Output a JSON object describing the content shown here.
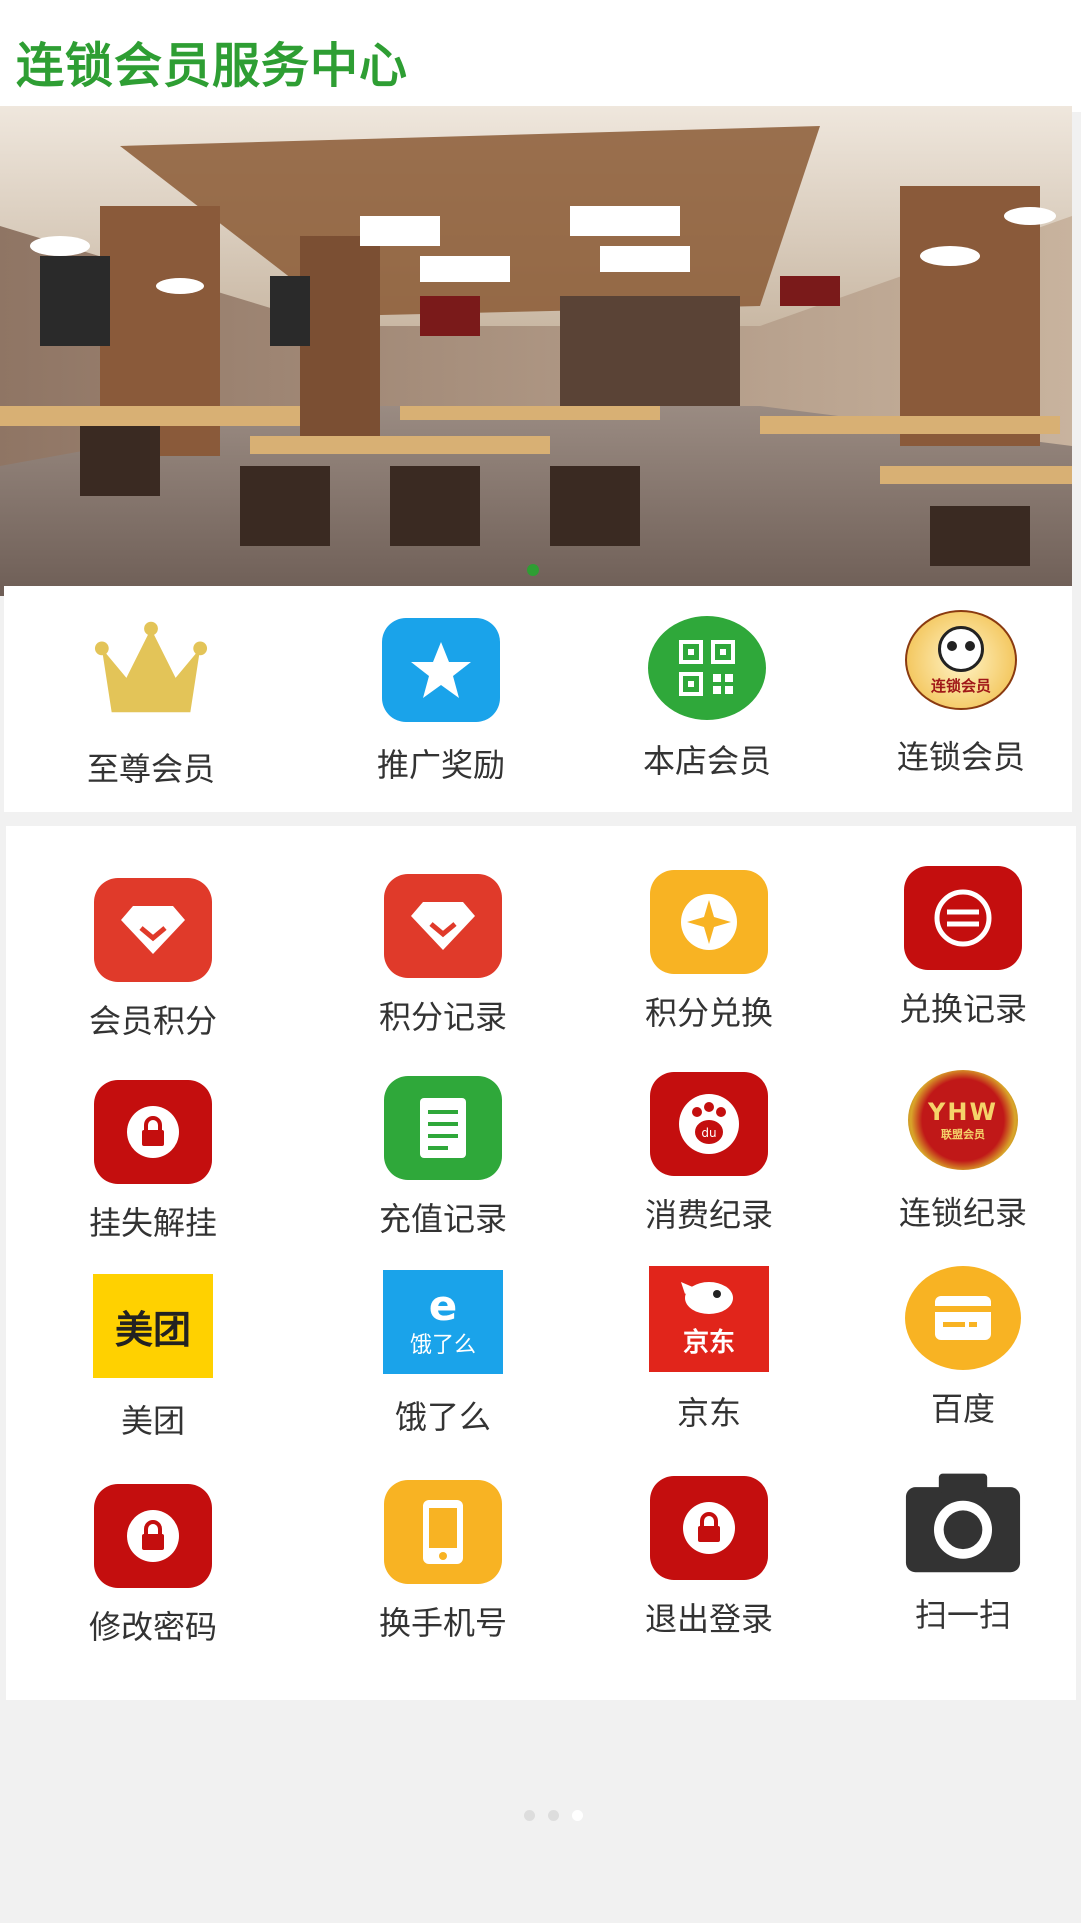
{
  "header": {
    "title": "连锁会员服务中心"
  },
  "top_menu": [
    {
      "label": "至尊会员",
      "icon": "crown-icon"
    },
    {
      "label": "推广奖励",
      "icon": "star-icon"
    },
    {
      "label": "本店会员",
      "icon": "qr-code-icon"
    },
    {
      "label": "连锁会员",
      "icon": "chain-member-logo-icon",
      "logo_text": "连锁会员"
    }
  ],
  "grid": [
    {
      "label": "会员积分",
      "icon": "diamond-icon"
    },
    {
      "label": "积分记录",
      "icon": "diamond-icon"
    },
    {
      "label": "积分兑换",
      "icon": "sparkle-icon"
    },
    {
      "label": "兑换记录",
      "icon": "exchange-icon"
    },
    {
      "label": "挂失解挂",
      "icon": "lock-icon"
    },
    {
      "label": "充值记录",
      "icon": "document-icon"
    },
    {
      "label": "消费纪录",
      "icon": "paw-icon",
      "logo_text": "du"
    },
    {
      "label": "连锁纪录",
      "icon": "yhw-badge-icon",
      "logo_text": "YHW",
      "logo_subtext": "联盟会员"
    },
    {
      "label": "美团",
      "icon": "meituan-logo-icon",
      "logo_text": "美团"
    },
    {
      "label": "饿了么",
      "icon": "eleme-logo-icon",
      "logo_text": "饿了么"
    },
    {
      "label": "京东",
      "icon": "jd-logo-icon",
      "logo_text": "京东"
    },
    {
      "label": "百度",
      "icon": "card-icon"
    },
    {
      "label": "修改密码",
      "icon": "lock-icon"
    },
    {
      "label": "换手机号",
      "icon": "phone-icon"
    },
    {
      "label": "退出登录",
      "icon": "lock-icon"
    },
    {
      "label": "扫一扫",
      "icon": "camera-icon"
    }
  ],
  "colors": {
    "brand_green": "#2e9e33",
    "red": "#e03a2a",
    "dark_red": "#c40e0e",
    "orange": "#f8b323",
    "blue": "#1aa3ea",
    "green": "#2fa83a",
    "meituan_yellow": "#ffd100",
    "jd_red": "#e1251b"
  },
  "banner": {
    "slides": 1,
    "active": 0
  },
  "pager": {
    "pages": 3,
    "active": 2
  }
}
